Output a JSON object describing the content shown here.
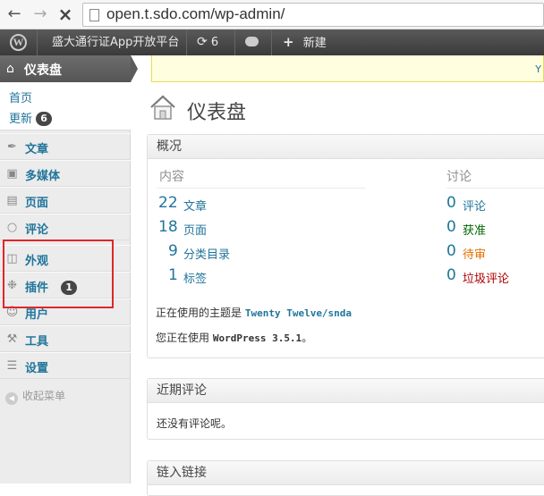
{
  "browser": {
    "back_icon": "arrow-left-icon",
    "forward_icon": "arrow-right-icon",
    "stop_icon": "close-icon",
    "url": "open.t.sdo.com/wp-admin/"
  },
  "adminbar": {
    "site_name": "盛大通行证App开放平台",
    "updates_count": "6",
    "new_label": "新建"
  },
  "sidebar": {
    "dashboard_label": "仪表盘",
    "submenu": {
      "home": "首页",
      "updates": "更新",
      "updates_count": "6"
    },
    "items": [
      {
        "label": "文章",
        "icon": "pin-icon"
      },
      {
        "label": "多媒体",
        "icon": "media-icon"
      },
      {
        "label": "页面",
        "icon": "page-icon"
      },
      {
        "label": "评论",
        "icon": "comment-icon"
      },
      {
        "label": "外观",
        "icon": "appearance-icon"
      },
      {
        "label": "插件",
        "icon": "plugin-icon",
        "count": "1"
      },
      {
        "label": "用户",
        "icon": "users-icon"
      },
      {
        "label": "工具",
        "icon": "tools-icon"
      },
      {
        "label": "设置",
        "icon": "settings-icon"
      }
    ],
    "collapse_label": "收起菜单"
  },
  "notice": {
    "link_text": "Y"
  },
  "main": {
    "title": "仪表盘",
    "right_now": {
      "title": "概况",
      "content_header": "内容",
      "discussion_header": "讨论",
      "content_rows": [
        {
          "num": "22",
          "label": "文章"
        },
        {
          "num": "18",
          "label": "页面"
        },
        {
          "num": "9",
          "label": "分类目录"
        },
        {
          "num": "1",
          "label": "标签"
        }
      ],
      "discussion_rows": [
        {
          "num": "0",
          "label": "评论",
          "color": "#21759b"
        },
        {
          "num": "0",
          "label": "获准",
          "color": "#006505"
        },
        {
          "num": "0",
          "label": "待审",
          "color": "#e66f00"
        },
        {
          "num": "0",
          "label": "垃圾评论",
          "color": "#b00000"
        }
      ],
      "theme_prefix": "正在使用的主题是",
      "theme_name": "Twenty Twelve/snda",
      "version_prefix": "您正在使用",
      "version_name": "WordPress 3.5.1",
      "version_suffix": "。"
    },
    "recent_comments": {
      "title": "近期评论",
      "empty_text": "还没有评论呢。"
    },
    "incoming_links": {
      "title": "链入链接"
    }
  }
}
